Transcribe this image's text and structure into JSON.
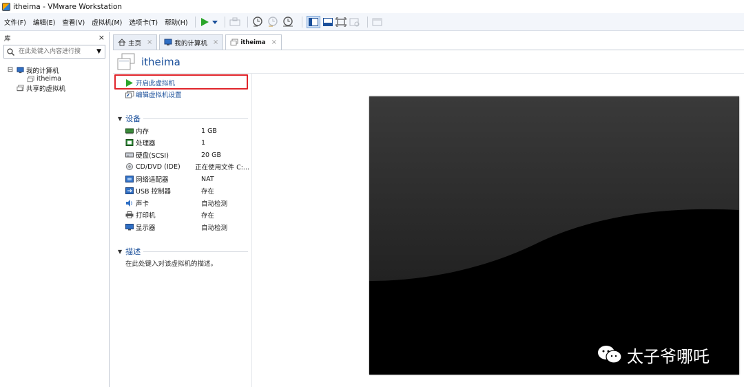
{
  "window": {
    "title": "itheima - VMware Workstation"
  },
  "menu": {
    "items": [
      "文件(F)",
      "编辑(E)",
      "查看(V)",
      "虚拟机(M)",
      "选项卡(T)",
      "帮助(H)"
    ]
  },
  "library": {
    "title": "库",
    "close": "×",
    "search_placeholder": "在此处键入内容进行搜",
    "tree": {
      "my_computer": "我的计算机",
      "vm": "itheima",
      "shared": "共享的虚拟机",
      "expander": "⊟"
    }
  },
  "tabs": [
    {
      "label": "主页",
      "close": "×"
    },
    {
      "label": "我的计算机",
      "close": "×"
    },
    {
      "label": "itheima",
      "close": "×"
    }
  ],
  "vm": {
    "name": "itheima",
    "actions": {
      "power_on": "开启此虚拟机",
      "edit_settings": "编辑虚拟机设置"
    },
    "devices_title": "设备",
    "devices": [
      {
        "name": "内存",
        "value": "1 GB",
        "icon": "memory-icon"
      },
      {
        "name": "处理器",
        "value": "1",
        "icon": "processor-icon"
      },
      {
        "name": "硬盘(SCSI)",
        "value": "20 GB",
        "icon": "hard-disk-icon"
      },
      {
        "name": "CD/DVD (IDE)",
        "value": "正在使用文件 C:...",
        "icon": "cd-dvd-icon"
      },
      {
        "name": "网络适配器",
        "value": "NAT",
        "icon": "network-adapter-icon"
      },
      {
        "name": "USB 控制器",
        "value": "存在",
        "icon": "usb-icon"
      },
      {
        "name": "声卡",
        "value": "自动检测",
        "icon": "sound-card-icon"
      },
      {
        "name": "打印机",
        "value": "存在",
        "icon": "printer-icon"
      },
      {
        "name": "显示器",
        "value": "自动检测",
        "icon": "display-icon"
      }
    ],
    "description_title": "描述",
    "description_placeholder": "在此处键入对该虚拟机的描述。"
  },
  "watermark": {
    "text": "太子爷哪吒"
  },
  "colors": {
    "accent_blue": "#1a4f9a",
    "highlight_red": "#e0242a",
    "play_green": "#2aa52a"
  }
}
